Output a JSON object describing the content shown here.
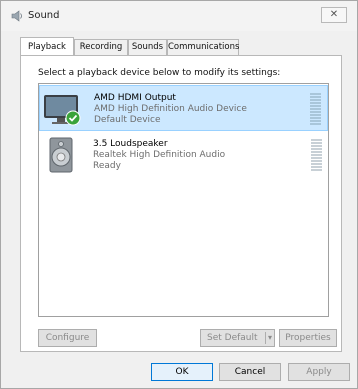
{
  "window": {
    "title": "Sound",
    "close_glyph": "✕"
  },
  "tabs": [
    {
      "label": "Playback",
      "active": true
    },
    {
      "label": "Recording",
      "active": false
    },
    {
      "label": "Sounds",
      "active": false
    },
    {
      "label": "Communications",
      "active": false
    }
  ],
  "playback": {
    "instruction": "Select a playback device below to modify its settings:",
    "devices": [
      {
        "name": "AMD HDMI Output",
        "driver": "AMD High Definition Audio Device",
        "status": "Default Device",
        "selected": true,
        "icon": "monitor-icon",
        "badge": "default-check-icon"
      },
      {
        "name": "3.5 Loudspeaker",
        "driver": "Realtek High Definition Audio",
        "status": "Ready",
        "selected": false,
        "icon": "speaker-icon"
      }
    ],
    "buttons": {
      "configure": "Configure",
      "set_default": "Set Default",
      "properties": "Properties"
    }
  },
  "dialog_buttons": {
    "ok": "OK",
    "cancel": "Cancel",
    "apply": "Apply"
  },
  "colors": {
    "selection": "#cce8ff",
    "selection_border": "#99d1ff",
    "primary_border": "#0078d7",
    "check_green": "#3aa33a"
  }
}
